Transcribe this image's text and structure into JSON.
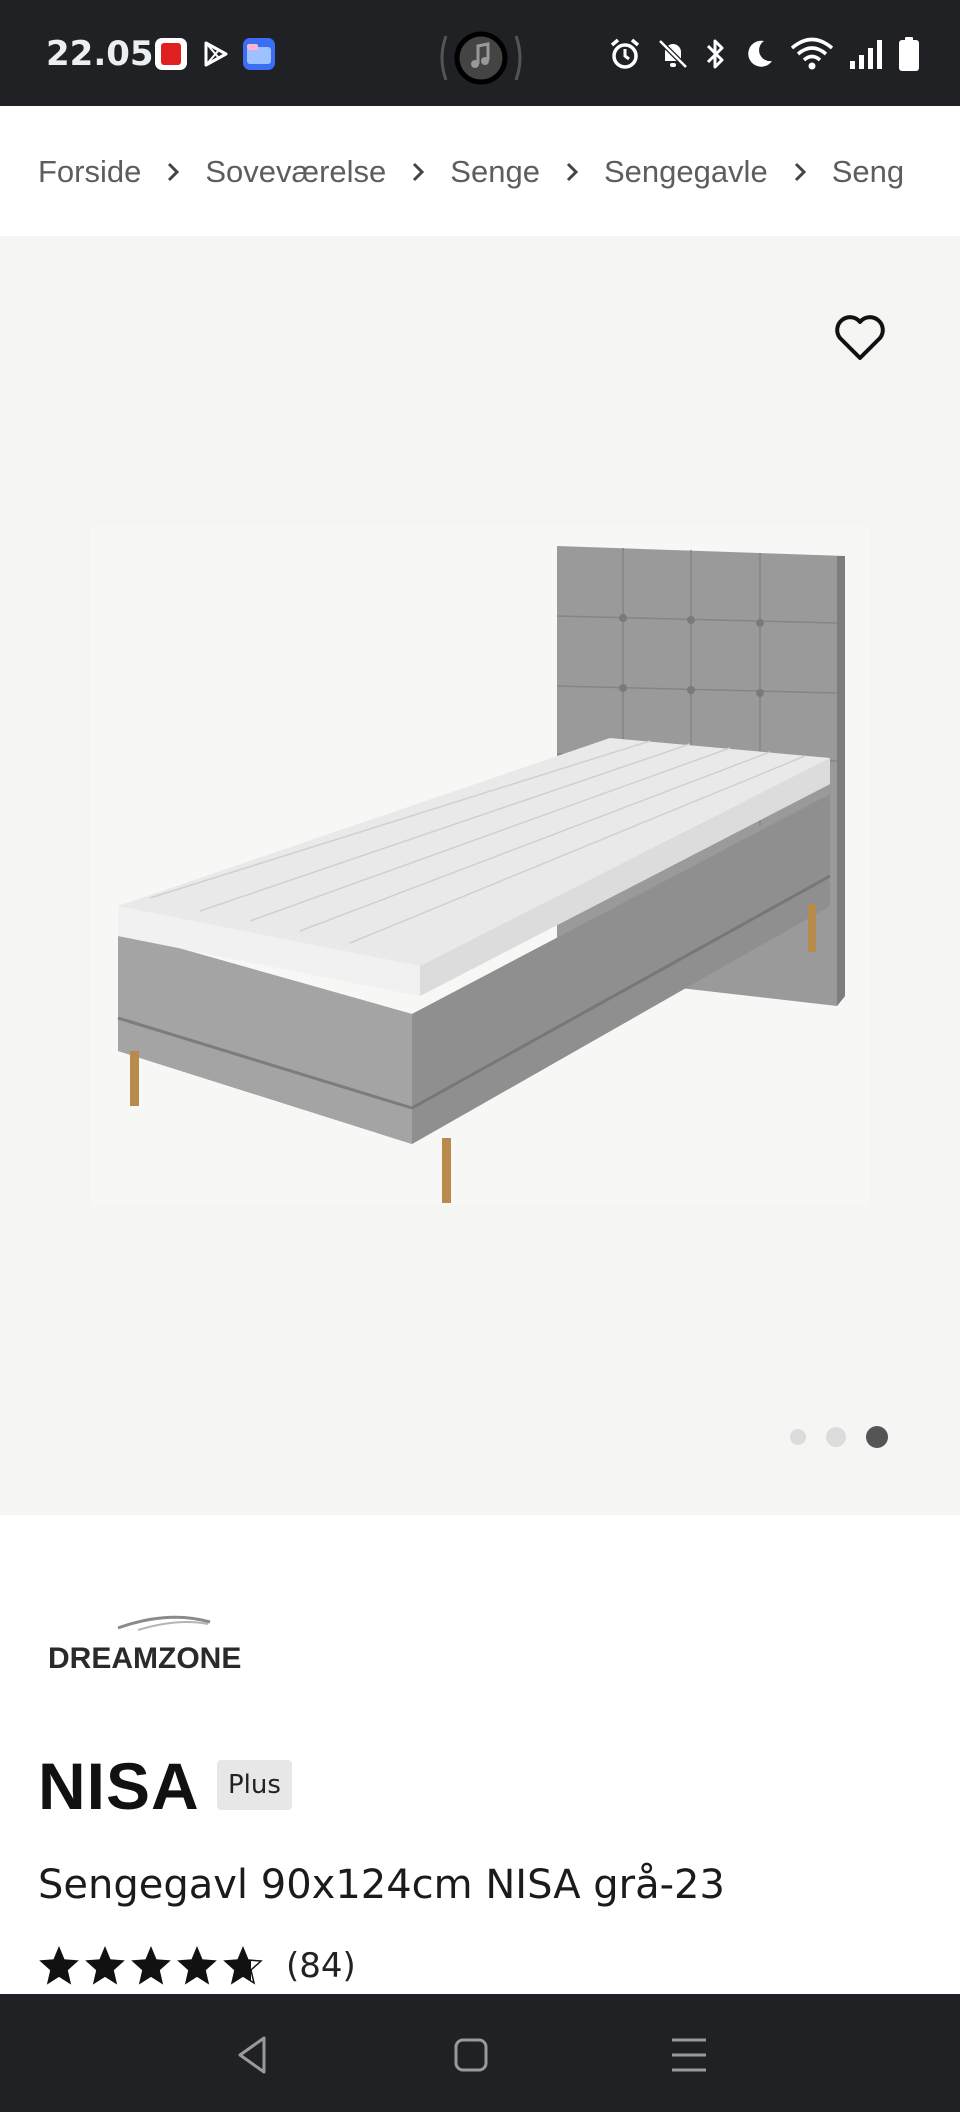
{
  "status_bar": {
    "time": "22.05",
    "app_icons": [
      "pdf-app-icon",
      "play-store-icon",
      "files-app-icon"
    ],
    "center_icon": "music-note-icon",
    "right_icons": [
      "alarm-icon",
      "notifications-muted-icon",
      "bluetooth-icon",
      "do-not-disturb-moon-icon",
      "wifi-icon",
      "signal-icon",
      "battery-icon"
    ]
  },
  "breadcrumb": {
    "items": [
      {
        "label": "Forside"
      },
      {
        "label": "Soveværelse"
      },
      {
        "label": "Senge"
      },
      {
        "label": "Sengegavle"
      },
      {
        "label": "Seng"
      }
    ]
  },
  "gallery": {
    "image_count": 3,
    "active_index": 3
  },
  "product": {
    "brand": "DREAMZONE",
    "name": "NISA",
    "badge": "Plus",
    "subtitle": "Sengegavl 90x124cm NISA grå-23",
    "rating_stars": 4.7,
    "review_count": "(84)"
  },
  "colors": {
    "status_bar_bg": "#202125",
    "gallery_bg": "#f5f5f4",
    "badge_bg": "#e7e7e7",
    "text": "#111111"
  }
}
